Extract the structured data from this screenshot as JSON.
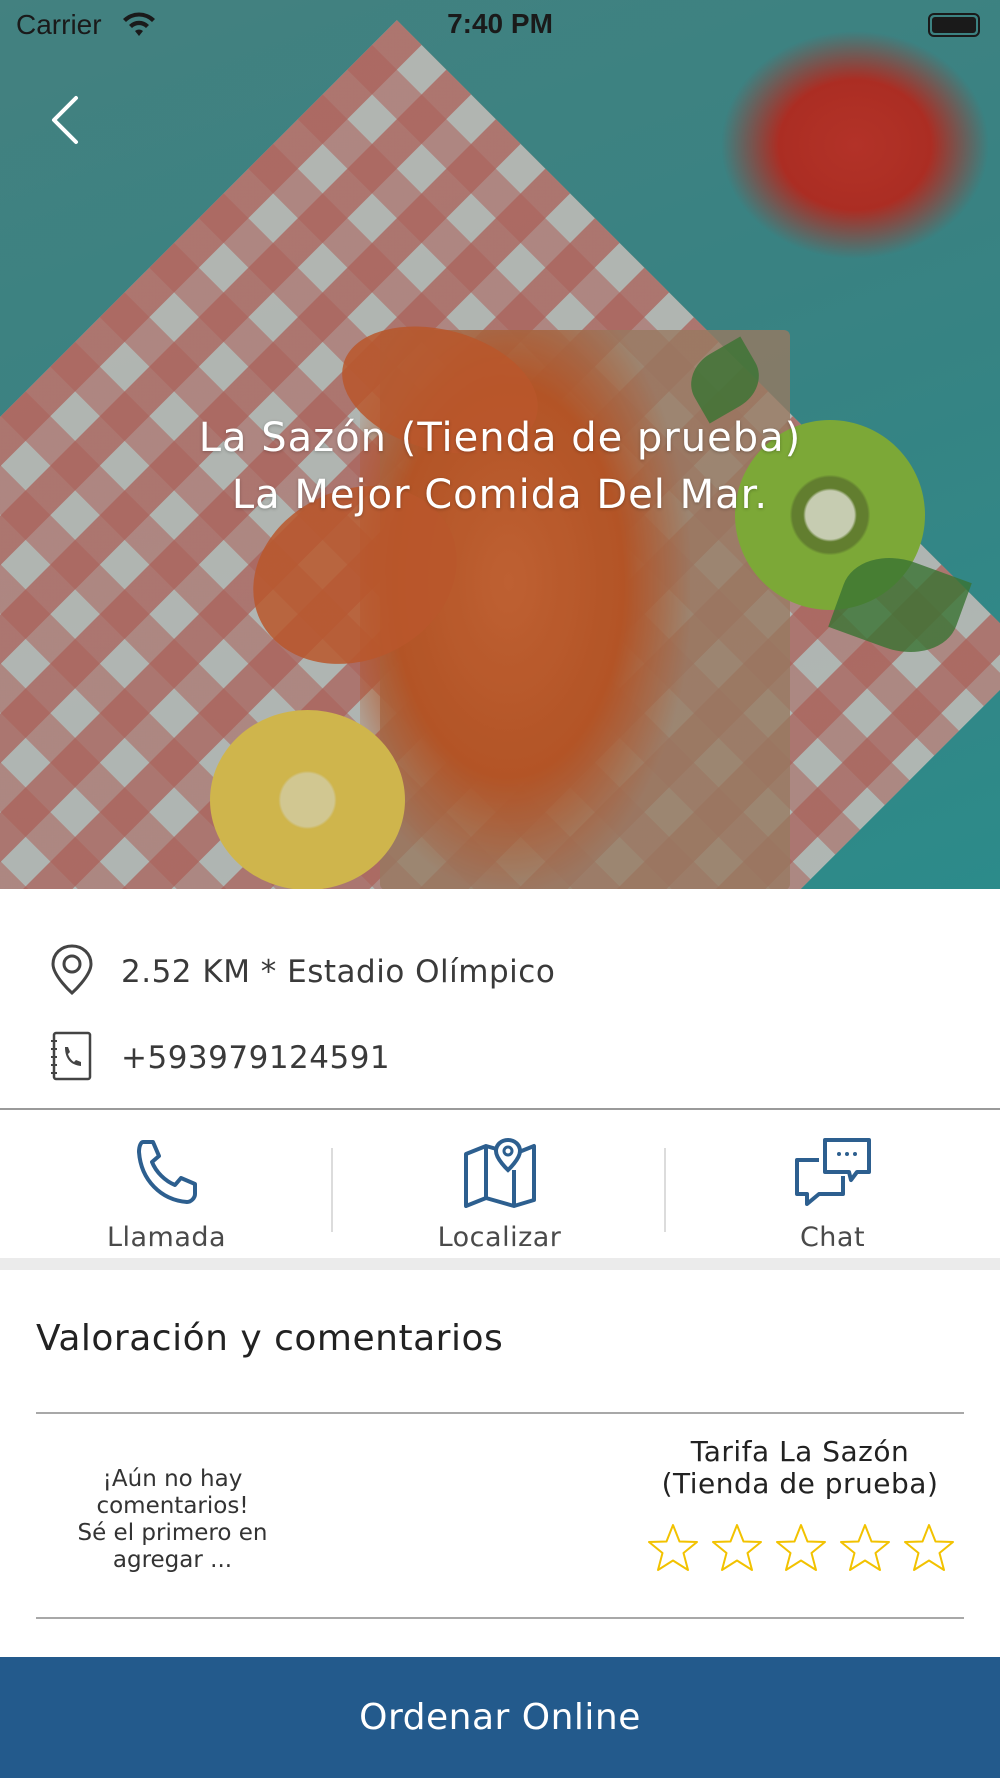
{
  "status_bar": {
    "carrier": "Carrier",
    "time": "7:40 PM"
  },
  "hero": {
    "title": "La Sazón (Tienda de prueba)",
    "subtitle": "La Mejor Comida Del Mar."
  },
  "info": {
    "location": "2.52 KM * Estadio Olímpico",
    "phone": "+593979124591"
  },
  "actions": [
    {
      "label": "Llamada",
      "icon": "phone-icon"
    },
    {
      "label": "Localizar",
      "icon": "map-pin-icon"
    },
    {
      "label": "Chat",
      "icon": "chat-bubbles-icon"
    }
  ],
  "reviews": {
    "title": "Valoración y comentarios",
    "empty_line1": "¡Aún no hay",
    "empty_line2": "comentarios!",
    "empty_line3": "Sé el primero en",
    "empty_line4": "agregar ...",
    "rate_line1": "Tarifa La Sazón",
    "rate_line2": "(Tienda de prueba)",
    "rating": 0,
    "max_rating": 5
  },
  "order_button": "Ordenar Online",
  "colors": {
    "brand_blue": "#235a8c",
    "icon_blue": "#2d5f8f",
    "star_yellow": "#f2c200"
  }
}
